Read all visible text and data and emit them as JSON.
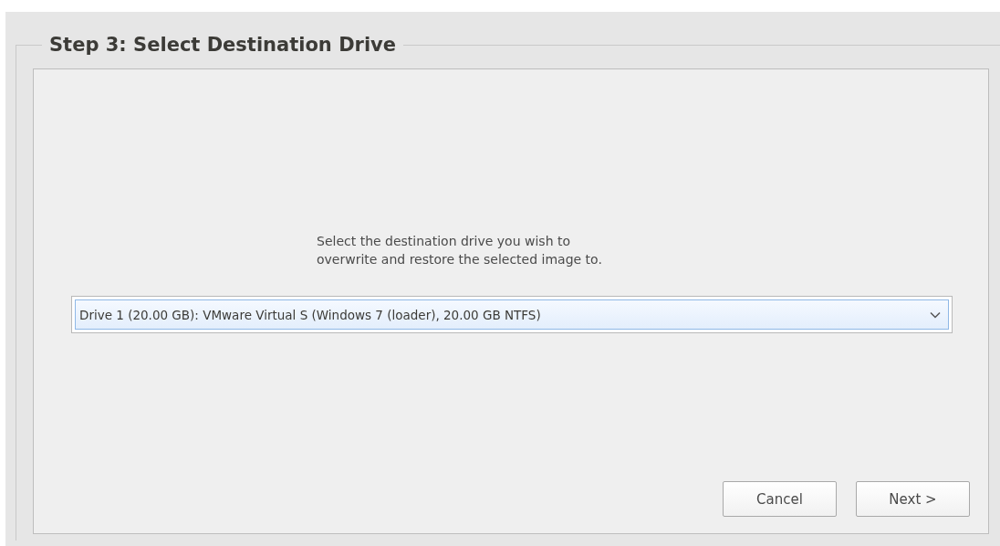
{
  "group": {
    "title": "Step 3: Select Destination Drive"
  },
  "instructions": "Select the destination drive you wish to\noverwrite and restore the selected image to.",
  "drive_dropdown": {
    "value": "Drive 1 (20.00 GB): VMware Virtual S (Windows 7 (loader), 20.00 GB NTFS)",
    "focused": true
  },
  "buttons": [
    {
      "label": "Cancel"
    },
    {
      "label": "Next >"
    }
  ]
}
